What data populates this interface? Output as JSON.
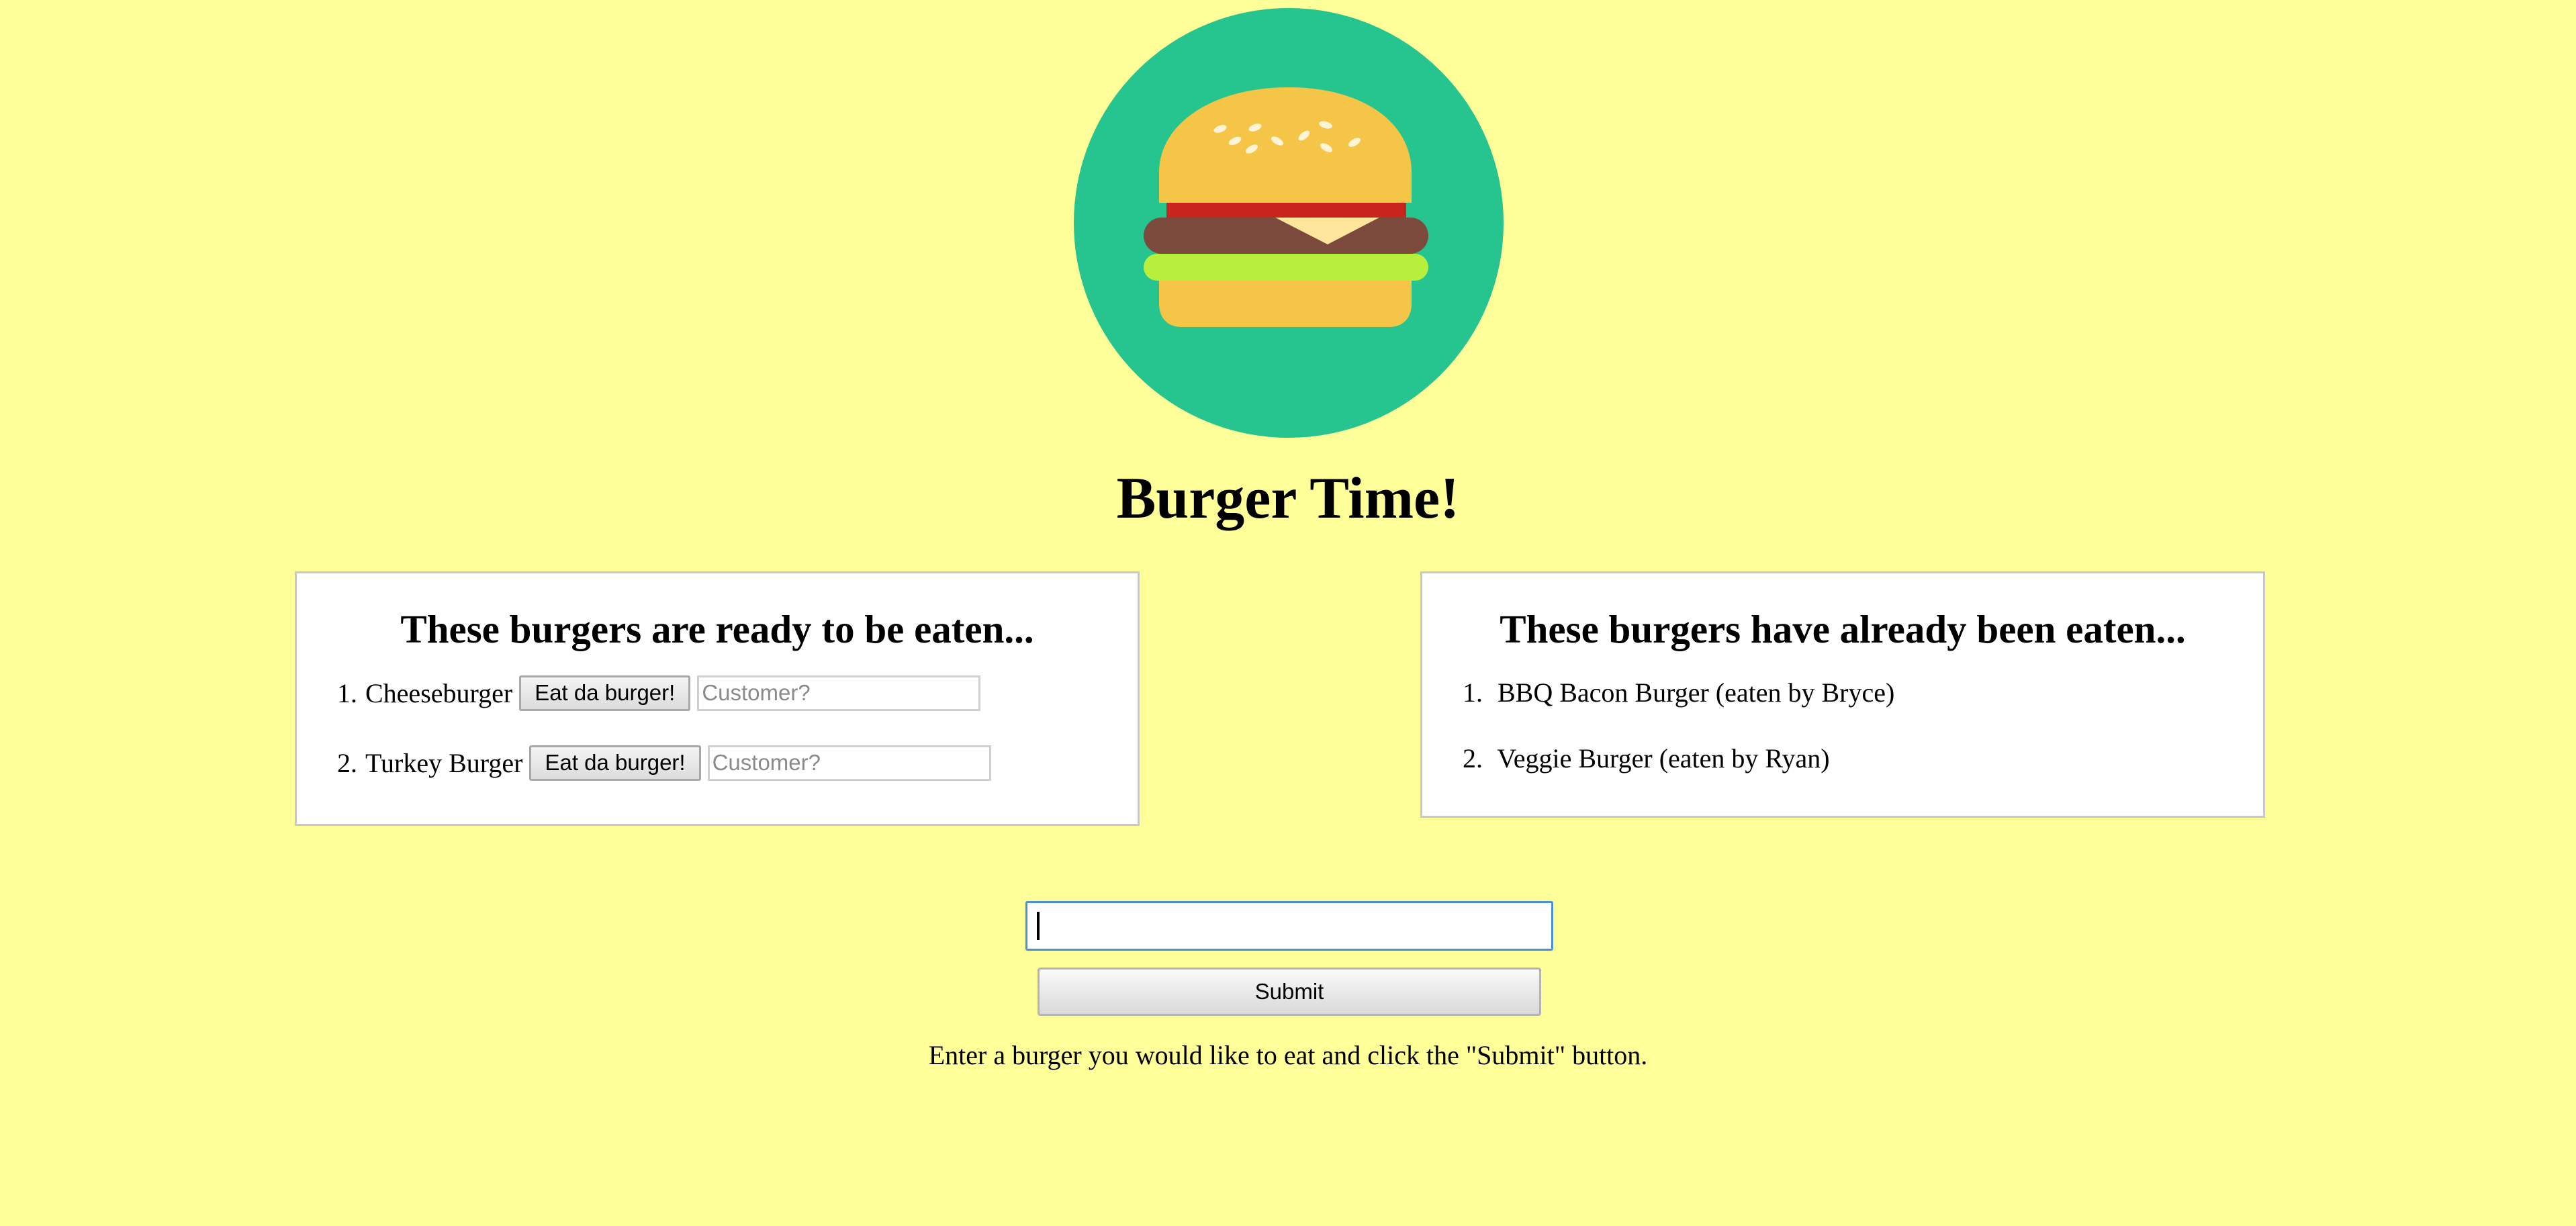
{
  "app": {
    "title": "Burger Time!"
  },
  "logo": {
    "icon": "burger-icon",
    "colors": {
      "circle": "#26c48f",
      "bun": "#f5c547",
      "tomato": "#c8261c",
      "patty": "#7b4a3c",
      "cheese": "#fde69b",
      "lettuce": "#b6f03c",
      "seeds": "#fff4d6"
    }
  },
  "ready_panel": {
    "heading": "These burgers are ready to be eaten...",
    "items": [
      {
        "number": "1.",
        "name": "Cheeseburger",
        "button_label": "Eat da burger!",
        "customer_placeholder": "Customer?",
        "customer_value": ""
      },
      {
        "number": "2.",
        "name": "Turkey Burger",
        "button_label": "Eat da burger!",
        "customer_placeholder": "Customer?",
        "customer_value": ""
      }
    ]
  },
  "eaten_panel": {
    "heading": "These burgers have already been eaten...",
    "items": [
      {
        "number": "1.",
        "text": "BBQ Bacon Burger (eaten by Bryce)"
      },
      {
        "number": "2.",
        "text": "Veggie Burger (eaten by Ryan)"
      }
    ]
  },
  "form": {
    "input_value": "",
    "submit_label": "Submit",
    "instructions": "Enter a burger you would like to eat and click the \"Submit\" button."
  },
  "colors": {
    "background": "#ffff99",
    "panel_border": "#c8c8c8",
    "focus_border": "#4a90d9"
  }
}
